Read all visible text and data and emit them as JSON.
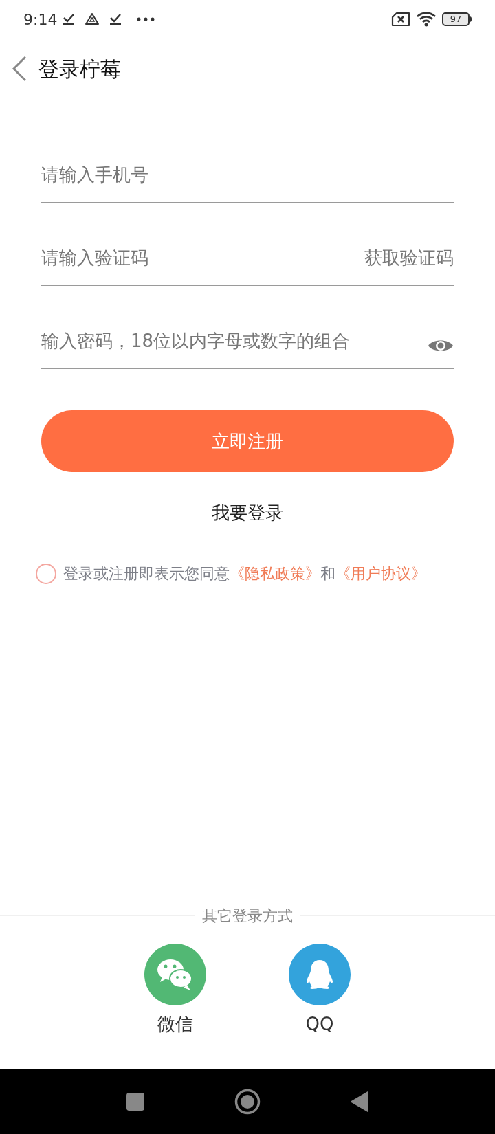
{
  "status_bar": {
    "time": "9:14",
    "battery": "97"
  },
  "header": {
    "title": "登录柠莓"
  },
  "fields": [
    {
      "kind": "phone",
      "placeholder": "请输入手机号"
    },
    {
      "kind": "code",
      "placeholder": "请输入验证码",
      "action": "获取验证码"
    },
    {
      "kind": "password",
      "placeholder": "输入密码，18位以内字母或数字的组合"
    }
  ],
  "primary_button": "立即注册",
  "secondary_link": "我要登录",
  "agreement": {
    "checked": false,
    "parts": [
      {
        "kind": "text",
        "text": "登录或注册即表示您同意"
      },
      {
        "kind": "link",
        "text": "《隐私政策》"
      },
      {
        "kind": "text",
        "text": "和"
      },
      {
        "kind": "link",
        "text": "《用户协议》"
      }
    ]
  },
  "other_login": {
    "title": "其它登录方式",
    "options": [
      {
        "kind": "wechat",
        "label": "微信"
      },
      {
        "kind": "qq",
        "label": "QQ"
      }
    ]
  }
}
